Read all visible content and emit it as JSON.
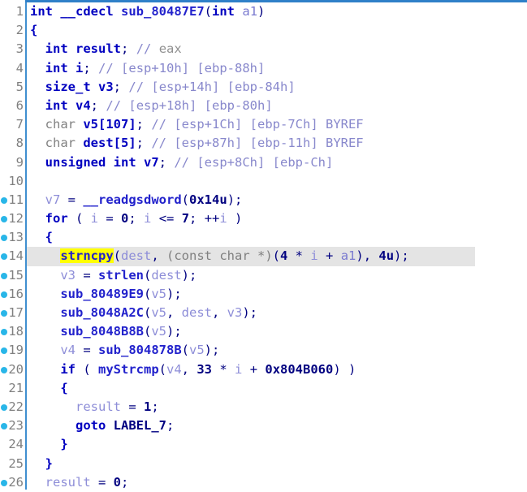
{
  "app": {
    "view": "ida-pseudocode",
    "accent_color": "#2f80c8",
    "gutter_rule_color": "#3f8fd0",
    "marker_color": "#29b6e8",
    "highlight_line_bg": "#e4e4e4",
    "token_highlight_bg": "#ffff00"
  },
  "code": {
    "language": "c",
    "function_signature": "int __cdecl sub_80487E7(int a1)",
    "highlighted_token": "strncpy",
    "highlighted_line_number": 14,
    "lines": [
      {
        "number": "1",
        "marker": false,
        "highlighted": false,
        "tokens": [
          {
            "t": "int",
            "c": "t-kw"
          },
          {
            "t": " ",
            "c": "t-plain"
          },
          {
            "t": "__cdecl",
            "c": "t-kw"
          },
          {
            "t": " ",
            "c": "t-plain"
          },
          {
            "t": "sub_80487E7",
            "c": "t-fn"
          },
          {
            "t": "(",
            "c": "t-punct"
          },
          {
            "t": "int",
            "c": "t-kw"
          },
          {
            "t": " ",
            "c": "t-plain"
          },
          {
            "t": "a1",
            "c": "t-arg"
          },
          {
            "t": ")",
            "c": "t-punct"
          }
        ]
      },
      {
        "number": "2",
        "marker": false,
        "highlighted": false,
        "tokens": [
          {
            "t": "{",
            "c": "t-kw"
          }
        ]
      },
      {
        "number": "3",
        "marker": false,
        "highlighted": false,
        "tokens": [
          {
            "t": "  ",
            "c": "t-plain"
          },
          {
            "t": "int",
            "c": "t-kw"
          },
          {
            "t": " result",
            "c": "t-kw"
          },
          {
            "t": ";",
            "c": "t-punct"
          },
          {
            "t": " ",
            "c": "t-plain"
          },
          {
            "t": "//",
            "c": "t-cmt"
          },
          {
            "t": " eax",
            "c": "t-cmt-g"
          }
        ]
      },
      {
        "number": "4",
        "marker": false,
        "highlighted": false,
        "tokens": [
          {
            "t": "  ",
            "c": "t-plain"
          },
          {
            "t": "int",
            "c": "t-kw"
          },
          {
            "t": " i",
            "c": "t-kw"
          },
          {
            "t": ";",
            "c": "t-punct"
          },
          {
            "t": " ",
            "c": "t-plain"
          },
          {
            "t": "//",
            "c": "t-cmt"
          },
          {
            "t": " [esp+10h] [ebp-88h]",
            "c": "t-cmt"
          }
        ]
      },
      {
        "number": "5",
        "marker": false,
        "highlighted": false,
        "tokens": [
          {
            "t": "  ",
            "c": "t-plain"
          },
          {
            "t": "size_t",
            "c": "t-kw"
          },
          {
            "t": " v3",
            "c": "t-kw"
          },
          {
            "t": ";",
            "c": "t-punct"
          },
          {
            "t": " ",
            "c": "t-plain"
          },
          {
            "t": "//",
            "c": "t-cmt"
          },
          {
            "t": " [esp+14h] [ebp-84h]",
            "c": "t-cmt"
          }
        ]
      },
      {
        "number": "6",
        "marker": false,
        "highlighted": false,
        "tokens": [
          {
            "t": "  ",
            "c": "t-plain"
          },
          {
            "t": "int",
            "c": "t-kw"
          },
          {
            "t": " v4",
            "c": "t-kw"
          },
          {
            "t": ";",
            "c": "t-punct"
          },
          {
            "t": " ",
            "c": "t-plain"
          },
          {
            "t": "//",
            "c": "t-cmt"
          },
          {
            "t": " [esp+18h] [ebp-80h]",
            "c": "t-cmt"
          }
        ]
      },
      {
        "number": "7",
        "marker": false,
        "highlighted": false,
        "tokens": [
          {
            "t": "  ",
            "c": "t-plain"
          },
          {
            "t": "char",
            "c": "t-cast"
          },
          {
            "t": " v5[107]",
            "c": "t-kw"
          },
          {
            "t": ";",
            "c": "t-punct"
          },
          {
            "t": " ",
            "c": "t-plain"
          },
          {
            "t": "//",
            "c": "t-cmt"
          },
          {
            "t": " [esp+1Ch] [ebp-7Ch] BYREF",
            "c": "t-cmt"
          }
        ]
      },
      {
        "number": "8",
        "marker": false,
        "highlighted": false,
        "tokens": [
          {
            "t": "  ",
            "c": "t-plain"
          },
          {
            "t": "char",
            "c": "t-cast"
          },
          {
            "t": " dest[5]",
            "c": "t-kw"
          },
          {
            "t": ";",
            "c": "t-punct"
          },
          {
            "t": " ",
            "c": "t-plain"
          },
          {
            "t": "//",
            "c": "t-cmt"
          },
          {
            "t": " [esp+87h] [ebp-11h] BYREF",
            "c": "t-cmt"
          }
        ]
      },
      {
        "number": "9",
        "marker": false,
        "highlighted": false,
        "tokens": [
          {
            "t": "  ",
            "c": "t-plain"
          },
          {
            "t": "unsigned int",
            "c": "t-kw"
          },
          {
            "t": " v7",
            "c": "t-kw"
          },
          {
            "t": ";",
            "c": "t-punct"
          },
          {
            "t": " ",
            "c": "t-plain"
          },
          {
            "t": "//",
            "c": "t-cmt"
          },
          {
            "t": " [esp+8Ch] [ebp-Ch]",
            "c": "t-cmt"
          }
        ]
      },
      {
        "number": "10",
        "marker": false,
        "highlighted": false,
        "tokens": []
      },
      {
        "number": "11",
        "marker": true,
        "highlighted": false,
        "tokens": [
          {
            "t": "  ",
            "c": "t-plain"
          },
          {
            "t": "v7",
            "c": "t-var"
          },
          {
            "t": " = ",
            "c": "t-punct"
          },
          {
            "t": "__readgsdword",
            "c": "t-fn"
          },
          {
            "t": "(",
            "c": "t-punct"
          },
          {
            "t": "0x14u",
            "c": "t-num"
          },
          {
            "t": ");",
            "c": "t-punct"
          }
        ]
      },
      {
        "number": "12",
        "marker": true,
        "highlighted": false,
        "tokens": [
          {
            "t": "  ",
            "c": "t-plain"
          },
          {
            "t": "for",
            "c": "t-kw"
          },
          {
            "t": " ( ",
            "c": "t-punct"
          },
          {
            "t": "i",
            "c": "t-var"
          },
          {
            "t": " = ",
            "c": "t-punct"
          },
          {
            "t": "0",
            "c": "t-num"
          },
          {
            "t": "; ",
            "c": "t-punct"
          },
          {
            "t": "i",
            "c": "t-var"
          },
          {
            "t": " <= ",
            "c": "t-punct"
          },
          {
            "t": "7",
            "c": "t-num"
          },
          {
            "t": "; ++",
            "c": "t-punct"
          },
          {
            "t": "i",
            "c": "t-var"
          },
          {
            "t": " )",
            "c": "t-punct"
          }
        ]
      },
      {
        "number": "13",
        "marker": true,
        "highlighted": false,
        "tokens": [
          {
            "t": "  ",
            "c": "t-plain"
          },
          {
            "t": "{",
            "c": "t-kw"
          }
        ]
      },
      {
        "number": "14",
        "marker": true,
        "highlighted": true,
        "tokens": [
          {
            "t": "    ",
            "c": "t-plain"
          },
          {
            "t": "strncpy",
            "c": "t-hl"
          },
          {
            "t": "(",
            "c": "t-punct"
          },
          {
            "t": "dest",
            "c": "t-var"
          },
          {
            "t": ", ",
            "c": "t-punct"
          },
          {
            "t": "(const char *)",
            "c": "t-cast"
          },
          {
            "t": "(",
            "c": "t-punct"
          },
          {
            "t": "4",
            "c": "t-num"
          },
          {
            "t": " * ",
            "c": "t-punct"
          },
          {
            "t": "i",
            "c": "t-var"
          },
          {
            "t": " + ",
            "c": "t-punct"
          },
          {
            "t": "a1",
            "c": "t-arg"
          },
          {
            "t": "), ",
            "c": "t-punct"
          },
          {
            "t": "4u",
            "c": "t-num"
          },
          {
            "t": ");",
            "c": "t-punct"
          }
        ]
      },
      {
        "number": "15",
        "marker": true,
        "highlighted": false,
        "tokens": [
          {
            "t": "    ",
            "c": "t-plain"
          },
          {
            "t": "v3",
            "c": "t-var"
          },
          {
            "t": " = ",
            "c": "t-punct"
          },
          {
            "t": "strlen",
            "c": "t-fn"
          },
          {
            "t": "(",
            "c": "t-punct"
          },
          {
            "t": "dest",
            "c": "t-var"
          },
          {
            "t": ");",
            "c": "t-punct"
          }
        ]
      },
      {
        "number": "16",
        "marker": true,
        "highlighted": false,
        "tokens": [
          {
            "t": "    ",
            "c": "t-plain"
          },
          {
            "t": "sub_80489E9",
            "c": "t-fn"
          },
          {
            "t": "(",
            "c": "t-punct"
          },
          {
            "t": "v5",
            "c": "t-var"
          },
          {
            "t": ");",
            "c": "t-punct"
          }
        ]
      },
      {
        "number": "17",
        "marker": true,
        "highlighted": false,
        "tokens": [
          {
            "t": "    ",
            "c": "t-plain"
          },
          {
            "t": "sub_8048A2C",
            "c": "t-fn"
          },
          {
            "t": "(",
            "c": "t-punct"
          },
          {
            "t": "v5",
            "c": "t-var"
          },
          {
            "t": ", ",
            "c": "t-punct"
          },
          {
            "t": "dest",
            "c": "t-var"
          },
          {
            "t": ", ",
            "c": "t-punct"
          },
          {
            "t": "v3",
            "c": "t-var"
          },
          {
            "t": ");",
            "c": "t-punct"
          }
        ]
      },
      {
        "number": "18",
        "marker": true,
        "highlighted": false,
        "tokens": [
          {
            "t": "    ",
            "c": "t-plain"
          },
          {
            "t": "sub_8048B8B",
            "c": "t-fn"
          },
          {
            "t": "(",
            "c": "t-punct"
          },
          {
            "t": "v5",
            "c": "t-var"
          },
          {
            "t": ");",
            "c": "t-punct"
          }
        ]
      },
      {
        "number": "19",
        "marker": true,
        "highlighted": false,
        "tokens": [
          {
            "t": "    ",
            "c": "t-plain"
          },
          {
            "t": "v4",
            "c": "t-var"
          },
          {
            "t": " = ",
            "c": "t-punct"
          },
          {
            "t": "sub_804878B",
            "c": "t-fn"
          },
          {
            "t": "(",
            "c": "t-punct"
          },
          {
            "t": "v5",
            "c": "t-var"
          },
          {
            "t": ");",
            "c": "t-punct"
          }
        ]
      },
      {
        "number": "20",
        "marker": true,
        "highlighted": false,
        "tokens": [
          {
            "t": "    ",
            "c": "t-plain"
          },
          {
            "t": "if",
            "c": "t-kw"
          },
          {
            "t": " ( ",
            "c": "t-punct"
          },
          {
            "t": "myStrcmp",
            "c": "t-fn"
          },
          {
            "t": "(",
            "c": "t-punct"
          },
          {
            "t": "v4",
            "c": "t-var"
          },
          {
            "t": ", ",
            "c": "t-punct"
          },
          {
            "t": "33",
            "c": "t-num"
          },
          {
            "t": " * ",
            "c": "t-punct"
          },
          {
            "t": "i",
            "c": "t-var"
          },
          {
            "t": " + ",
            "c": "t-punct"
          },
          {
            "t": "0x804B060",
            "c": "t-num"
          },
          {
            "t": ") )",
            "c": "t-punct"
          }
        ]
      },
      {
        "number": "21",
        "marker": false,
        "highlighted": false,
        "tokens": [
          {
            "t": "    ",
            "c": "t-plain"
          },
          {
            "t": "{",
            "c": "t-kw"
          }
        ]
      },
      {
        "number": "22",
        "marker": true,
        "highlighted": false,
        "tokens": [
          {
            "t": "      ",
            "c": "t-plain"
          },
          {
            "t": "result",
            "c": "t-var"
          },
          {
            "t": " = ",
            "c": "t-punct"
          },
          {
            "t": "1",
            "c": "t-num"
          },
          {
            "t": ";",
            "c": "t-punct"
          }
        ]
      },
      {
        "number": "23",
        "marker": true,
        "highlighted": false,
        "tokens": [
          {
            "t": "      ",
            "c": "t-plain"
          },
          {
            "t": "goto",
            "c": "t-kw"
          },
          {
            "t": " ",
            "c": "t-plain"
          },
          {
            "t": "LABEL_7",
            "c": "t-label"
          },
          {
            "t": ";",
            "c": "t-punct"
          }
        ]
      },
      {
        "number": "24",
        "marker": false,
        "highlighted": false,
        "tokens": [
          {
            "t": "    ",
            "c": "t-plain"
          },
          {
            "t": "}",
            "c": "t-kw"
          }
        ]
      },
      {
        "number": "25",
        "marker": false,
        "highlighted": false,
        "tokens": [
          {
            "t": "  ",
            "c": "t-plain"
          },
          {
            "t": "}",
            "c": "t-kw"
          }
        ]
      },
      {
        "number": "26",
        "marker": true,
        "highlighted": false,
        "tokens": [
          {
            "t": "  ",
            "c": "t-plain"
          },
          {
            "t": "result",
            "c": "t-var"
          },
          {
            "t": " = ",
            "c": "t-punct"
          },
          {
            "t": "0",
            "c": "t-num"
          },
          {
            "t": ";",
            "c": "t-punct"
          }
        ]
      }
    ]
  }
}
